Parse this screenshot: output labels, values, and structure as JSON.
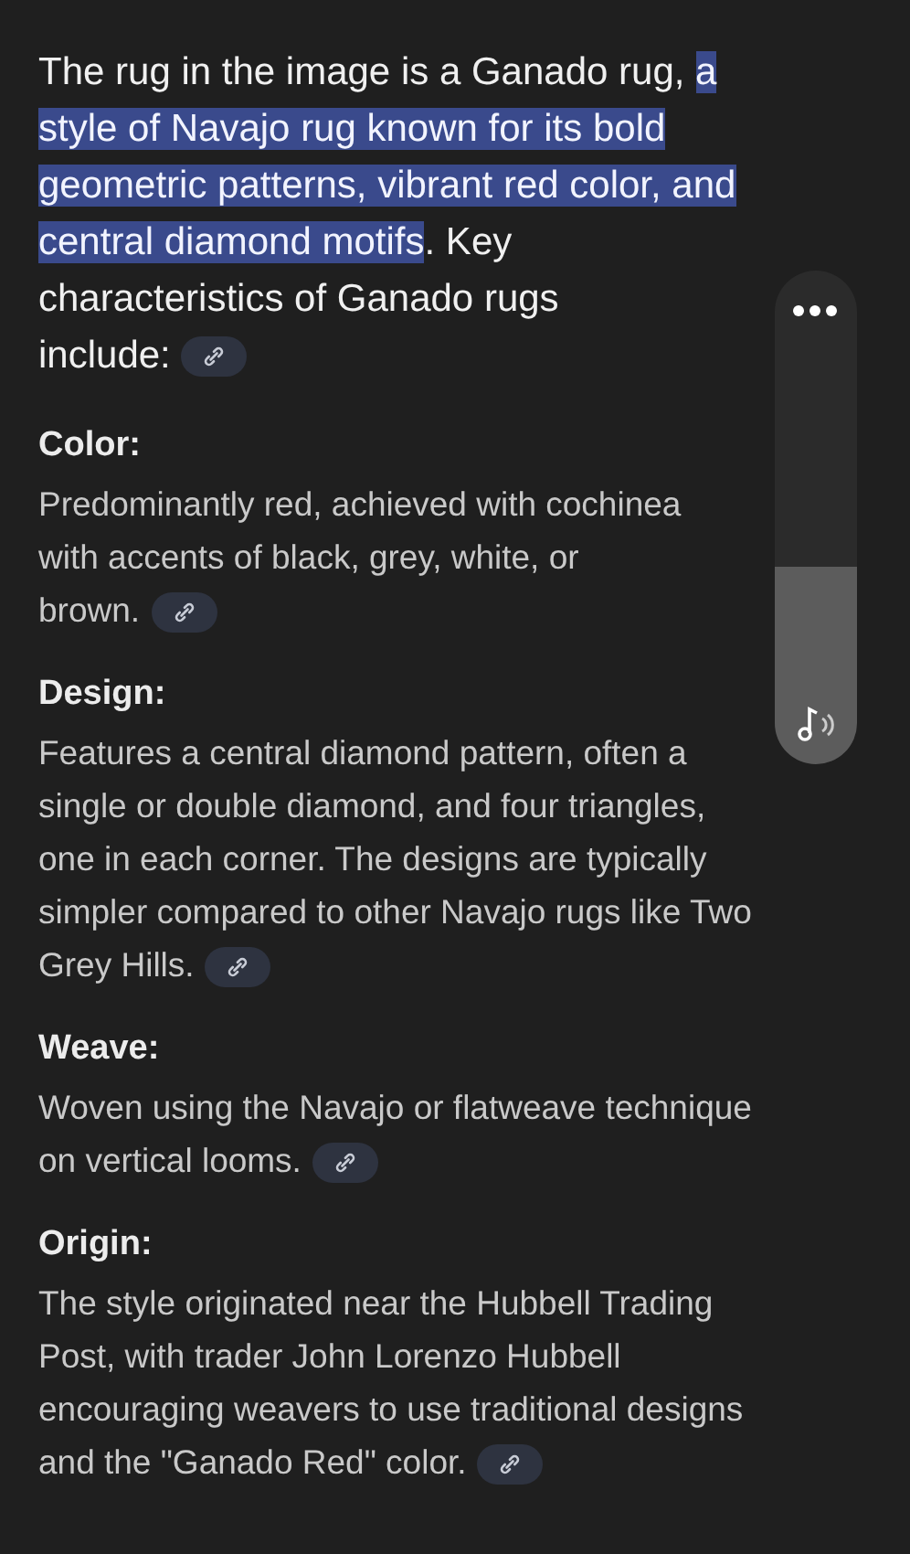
{
  "intro": {
    "segments": [
      {
        "text": "The rug in the image is a Ganado rug, ",
        "selected": false
      },
      {
        "text": "a\nstyle of Navajo rug known for its bold\ngeometric patterns, vibrant red color, and\ncentral diamond motifs",
        "selected": true
      },
      {
        "text": ". Key\ncharacteristics of Ganado rugs\ninclude:",
        "selected": false
      }
    ],
    "has_source_link": true
  },
  "sections": [
    {
      "heading": "Color:",
      "body": "Predominantly red, achieved with cochinea\nwith accents of black, grey, white, or\nbrown.",
      "has_source_link": true
    },
    {
      "heading": "Design:",
      "body": "Features a central diamond pattern, often a\nsingle or double diamond, and four triangles,\none in each corner. The designs are typically\nsimpler compared to other Navajo rugs like Two\nGrey Hills.",
      "has_source_link": true
    },
    {
      "heading": "Weave:",
      "body": "Woven using the Navajo or flatweave technique\non vertical looms.",
      "has_source_link": true
    },
    {
      "heading": "Origin:",
      "body": "The style originated near the Hubbell Trading\nPost, with trader John Lorenzo Hubbell\nencouraging weavers to use traditional designs\nand the \"Ganado Red\" color.",
      "has_source_link": true
    }
  ],
  "volume_slider": {
    "level": 0.4
  }
}
